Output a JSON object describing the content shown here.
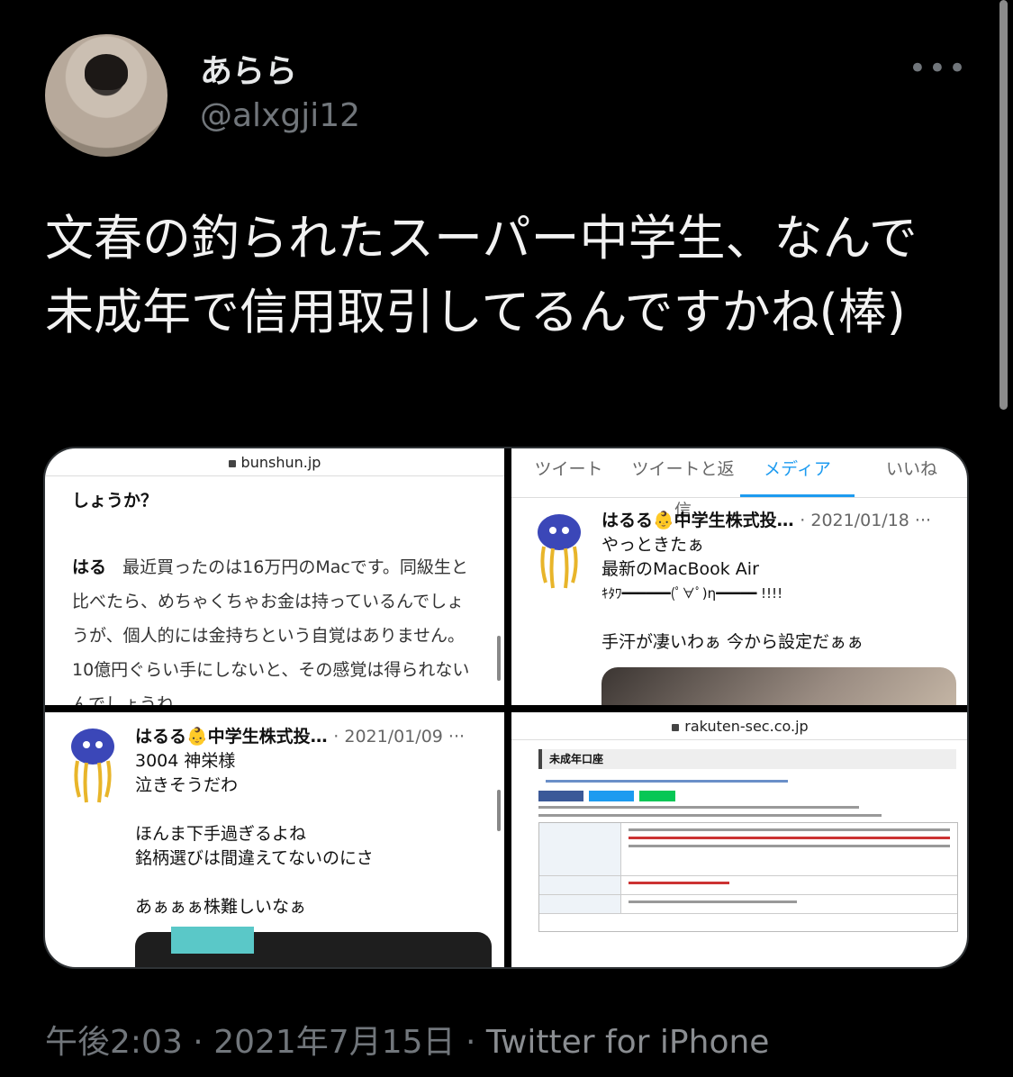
{
  "author": {
    "name": "あらら",
    "handle": "@alxgji12"
  },
  "tweet_text": "文春の釣られたスーパー中学生、なんで未成年で信用取引してるんですかね(棒)",
  "media": {
    "article": {
      "url": "bunshun.jp",
      "lead": "しょうか？",
      "speaker": "はる",
      "body": "最近買ったのは16万円のMacです。同級生と比べたら、めちゃくちゃお金は持っているんでしょうが、個人的には金持ちという自覚はありません。10億円ぐらい手にしないと、その感覚は得られないんでしょうね"
    },
    "profile": {
      "tabs": [
        "ツイート",
        "ツイートと返信",
        "メディア",
        "いいね"
      ],
      "post": {
        "name": "はるる👶中学生株式投…",
        "date": "· 2021/01/18 ···",
        "lines": [
          "やっときたぁ",
          "最新のMacBook Air",
          "ｷﾀﾜ━━━━━━(ﾟ∀ﾟ)η━━━━━ !!!!",
          "",
          "手汗が凄いわぁ 今から設定だぁぁ"
        ]
      }
    },
    "post2": {
      "name": "はるる👶中学生株式投…",
      "date": "· 2021/01/09 ···",
      "lines": [
        "3004 神栄様",
        "泣きそうだわ",
        "",
        "ほんま下手過ぎるよね",
        "銘柄選びは間違えてないのにさ",
        "",
        "あぁぁぁ株難しいなぁ"
      ]
    },
    "rakuten": {
      "url": "rakuten-sec.co.jp",
      "title": "未成年口座"
    }
  },
  "footer": {
    "time": "午後2:03",
    "date": "2021年7月15日",
    "source": "Twitter for iPhone",
    "sep": " · "
  }
}
